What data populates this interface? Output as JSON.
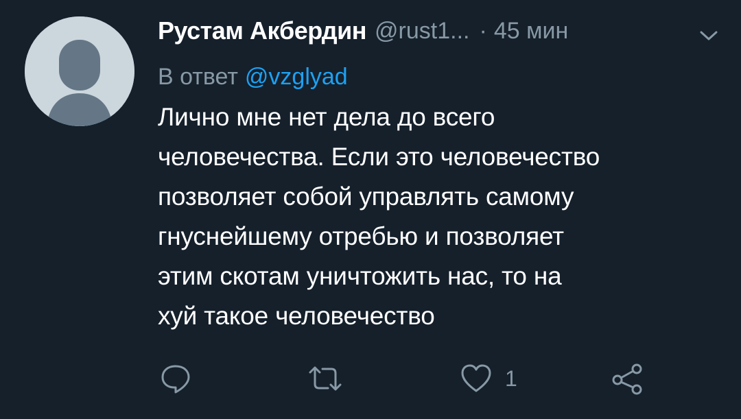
{
  "tweet": {
    "author": {
      "display_name": "Рустам Акбердин",
      "handle": "@rust1...",
      "avatar_icon": "default-avatar-icon"
    },
    "separator": "·",
    "time": "45 мин",
    "menu_icon": "chevron-down-icon",
    "reply_to": {
      "prefix": "В ответ",
      "mention": "@vzglyad"
    },
    "text": "Лично мне нет дела до всего\nчеловечества. Если это человечество\nпозволяет собой управлять самому\nгнуснейшему отребью и позволяет\nэтим скотам уничтожить нас, то на\nхуй такое человечество"
  },
  "actions": {
    "reply": {
      "icon": "reply-icon",
      "count": ""
    },
    "retweet": {
      "icon": "retweet-icon",
      "count": ""
    },
    "like": {
      "icon": "heart-icon",
      "count": "1"
    },
    "share": {
      "icon": "share-icon",
      "count": ""
    }
  },
  "colors": {
    "background": "#15202b",
    "primary_text": "#ffffff",
    "secondary_text": "#8899a6",
    "accent": "#1da1f2",
    "avatar_bg": "#ccd6dd",
    "avatar_fg": "#657786"
  }
}
